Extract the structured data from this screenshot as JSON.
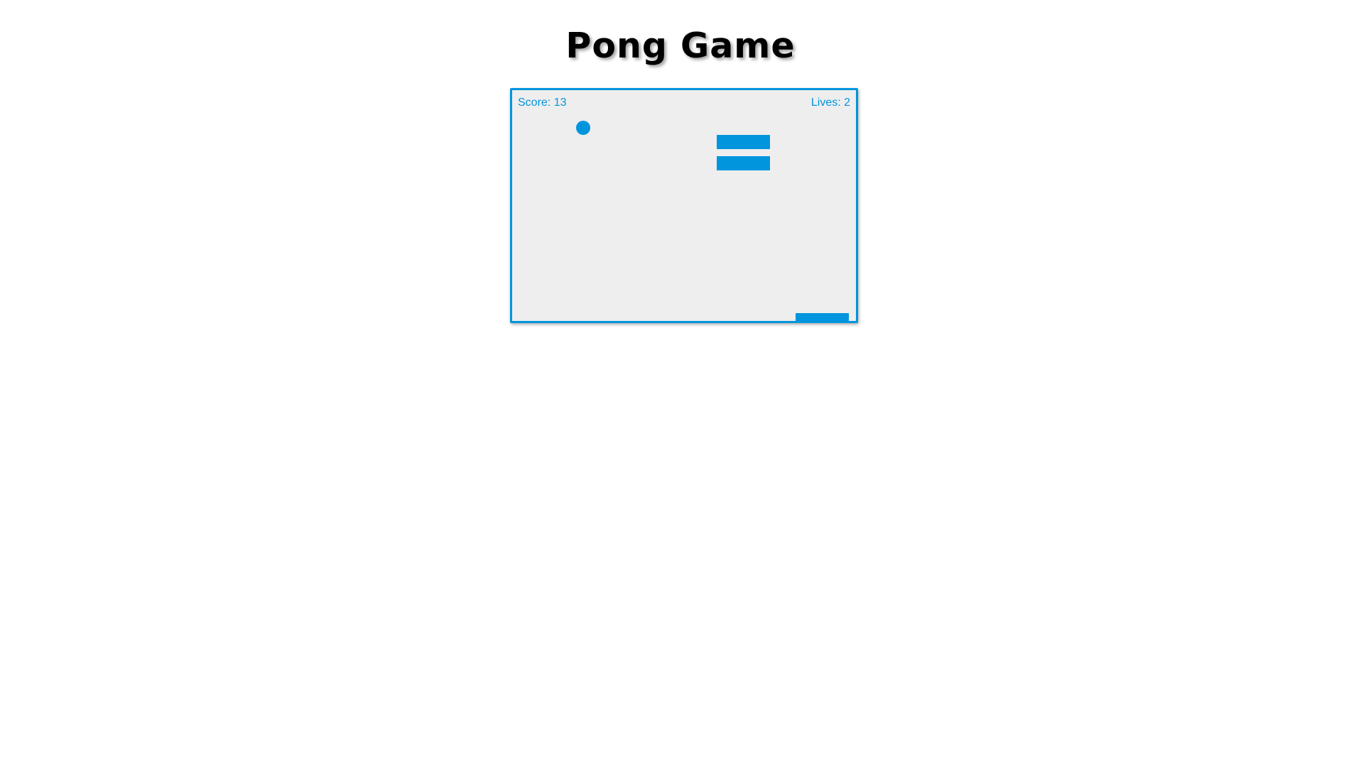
{
  "page": {
    "title": "Pong Game"
  },
  "game": {
    "score_text": "Score: 13",
    "lives_text": "Lives: 2",
    "score": 13,
    "lives": 2,
    "remaining_bricks": 2,
    "accent_color": "#0095dd",
    "board_background": "#eeeeee"
  }
}
